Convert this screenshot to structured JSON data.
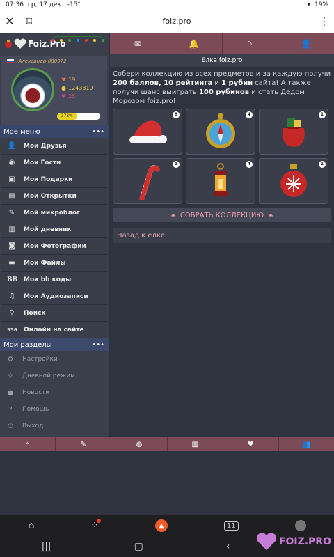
{
  "statusbar": {
    "time": "07:36",
    "date": "ср, 17 дек.",
    "temp": "-15°",
    "battery": "19%"
  },
  "browser": {
    "url": "foiz.pro"
  },
  "sidebar": {
    "logo_text": "Foiz.Pro",
    "username": "-Александр-080972",
    "stats": {
      "rating": "19",
      "coins": "1243319",
      "likes": "25"
    },
    "progress_label": "378%",
    "progress_value": 0.46,
    "menu_title": "Мое меню",
    "menu": [
      {
        "label": "Мои Друзья",
        "icon": "user-icon"
      },
      {
        "label": "Мои Гости",
        "icon": "eye-icon"
      },
      {
        "label": "Мои Подарки",
        "icon": "gift-icon"
      },
      {
        "label": "Мои Открытки",
        "icon": "card-icon"
      },
      {
        "label": "Мой микроблог",
        "icon": "edit-icon"
      },
      {
        "label": "Мой дневник",
        "icon": "book-icon"
      },
      {
        "label": "Мои Фотографии",
        "icon": "camera-icon"
      },
      {
        "label": "Мои Файлы",
        "icon": "folder-icon"
      },
      {
        "label": "Мои bb коды",
        "icon": "bb-icon"
      },
      {
        "label": "Мои Аудиозаписи",
        "icon": "music-icon"
      },
      {
        "label": "Поиск",
        "icon": "search-icon"
      },
      {
        "label": "Онлайн на сайте",
        "icon": "online-icon",
        "count": "356"
      }
    ],
    "sections_title": "Мои разделы",
    "sections": [
      {
        "label": "Настройки",
        "icon": "gear-icon"
      },
      {
        "label": "Дневной режим",
        "icon": "sun-icon"
      },
      {
        "label": "Новости",
        "icon": "globe-icon"
      },
      {
        "label": "Помощь",
        "icon": "help-icon"
      },
      {
        "label": "Выход",
        "icon": "power-icon"
      }
    ]
  },
  "main": {
    "title": "Елка foiz.pro",
    "intro_a": "Собери коллекцию из всех предметов и за каждую получи ",
    "intro_b1": "200 баллов, 10 рейтинга",
    "intro_c": " и ",
    "intro_b2": "1 рубин",
    "intro_d": " сайта! А также получи шанс выиграть ",
    "intro_b3": "100 рубинов",
    "intro_e": " и стать Дедом Морозом foiz.pro!",
    "items": [
      {
        "name": "santa-hat",
        "count": "8"
      },
      {
        "name": "compass",
        "count": "4"
      },
      {
        "name": "gift-sack",
        "count": "1"
      },
      {
        "name": "candy-cane",
        "count": "1"
      },
      {
        "name": "lantern",
        "count": "4"
      },
      {
        "name": "bauble",
        "count": "1"
      }
    ],
    "collect_label": "СОБРАТЬ КОЛЛЕКЦИЮ",
    "back_label": "Назад к елке"
  },
  "colors": {
    "accent": "#7d4a57",
    "link": "#e6a3b3",
    "progress": "#e8d21e"
  }
}
